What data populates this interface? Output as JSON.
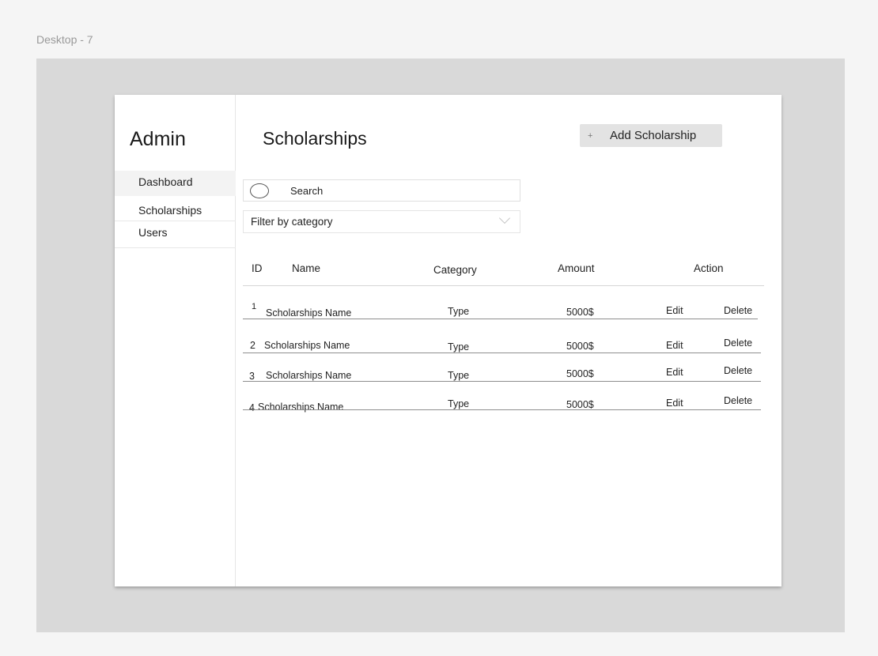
{
  "frame_label": "Desktop - 7",
  "sidebar": {
    "brand": "Admin",
    "items": [
      {
        "label": "Dashboard"
      },
      {
        "label": "Scholarships"
      },
      {
        "label": "Users"
      }
    ]
  },
  "header": {
    "title": "Scholarships",
    "add_icon": "+",
    "add_label": "Add Scholarship"
  },
  "search": {
    "placeholder": "Search"
  },
  "filter": {
    "placeholder": "Filter by category"
  },
  "table": {
    "columns": {
      "id": "ID",
      "name": "Name",
      "category": "Category",
      "amount": "Amount",
      "action": "Action"
    },
    "rows": [
      {
        "id": "1",
        "name": "Scholarships Name",
        "category": "Type",
        "amount": "5000$",
        "edit": "Edit",
        "delete": "Delete"
      },
      {
        "id": "2",
        "name": "Scholarships Name",
        "category": "Type",
        "amount": "5000$",
        "edit": "Edit",
        "delete": "Delete"
      },
      {
        "id": "3",
        "name": "Scholarships Name",
        "category": "Type",
        "amount": "5000$",
        "edit": "Edit",
        "delete": "Delete"
      },
      {
        "id": "4",
        "name": "Scholarships Name",
        "category": "Type",
        "amount": "5000$",
        "edit": "Edit",
        "delete": "Delete"
      }
    ]
  }
}
